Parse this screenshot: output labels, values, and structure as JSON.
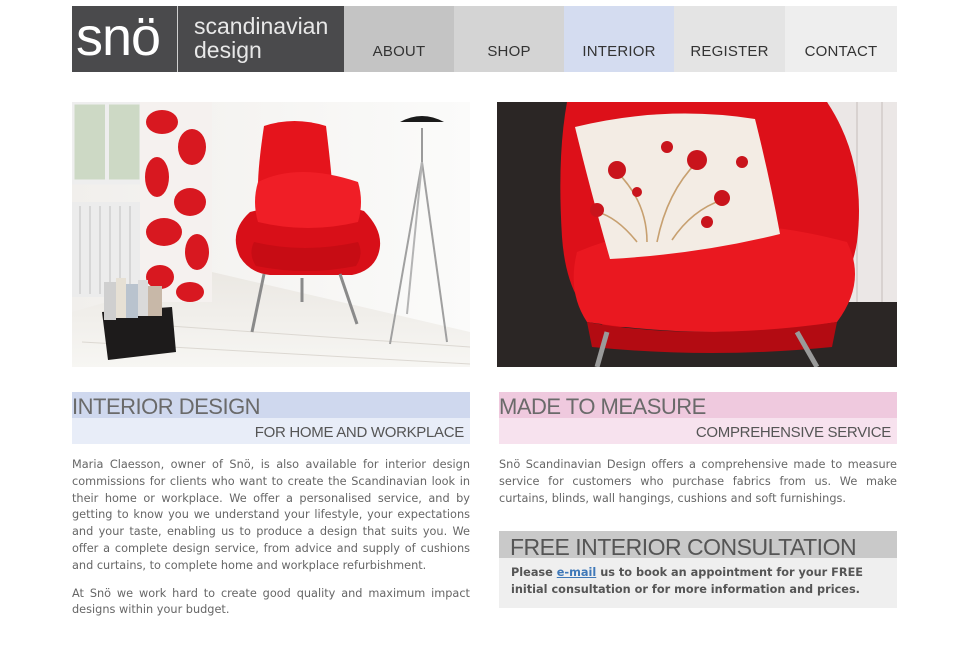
{
  "logo": {
    "mark": "snö",
    "line1": "scandinavian",
    "line2": "design"
  },
  "nav": {
    "items": [
      {
        "label": "ABOUT"
      },
      {
        "label": "SHOP"
      },
      {
        "label": "INTERIOR"
      },
      {
        "label": "REGISTER"
      },
      {
        "label": "CONTACT"
      }
    ]
  },
  "colors": {
    "logo_bg": "#4a4a4c",
    "accent_red": "#e0101a",
    "interior_blue": "#cfd8ee",
    "made_pink": "#efc9de",
    "consult_grey": "#c9c9c9"
  },
  "interior": {
    "title": "INTERIOR DESIGN",
    "subtitle": "FOR HOME AND WORKPLACE",
    "p1": "Maria Claesson, owner of Snö, is also available for interior design commissions for clients who want to create the Scandinavian look in their home or workplace. We offer a personalised service, and by getting to know you we understand your lifestyle, your expectations and your taste, enabling us to produce a design that suits you. We offer a complete design service, from advice and supply of cushions and curtains, to complete home and workplace refurbishment.",
    "p2": "At Snö we work hard to create good quality and maximum impact designs within your budget."
  },
  "made_to_measure": {
    "title": "MADE TO MEASURE",
    "subtitle": "COMPREHENSIVE SERVICE",
    "p1": "Snö Scandinavian Design offers a comprehensive made to measure service for customers who purchase fabrics from us. We make curtains, blinds, wall hangings, cushions and soft furnishings."
  },
  "consultation": {
    "title": "FREE INTERIOR CONSULTATION",
    "before": "Please ",
    "link": "e-mail",
    "after": " us to book an appointment for your FREE initial consultation or for more information and prices."
  }
}
